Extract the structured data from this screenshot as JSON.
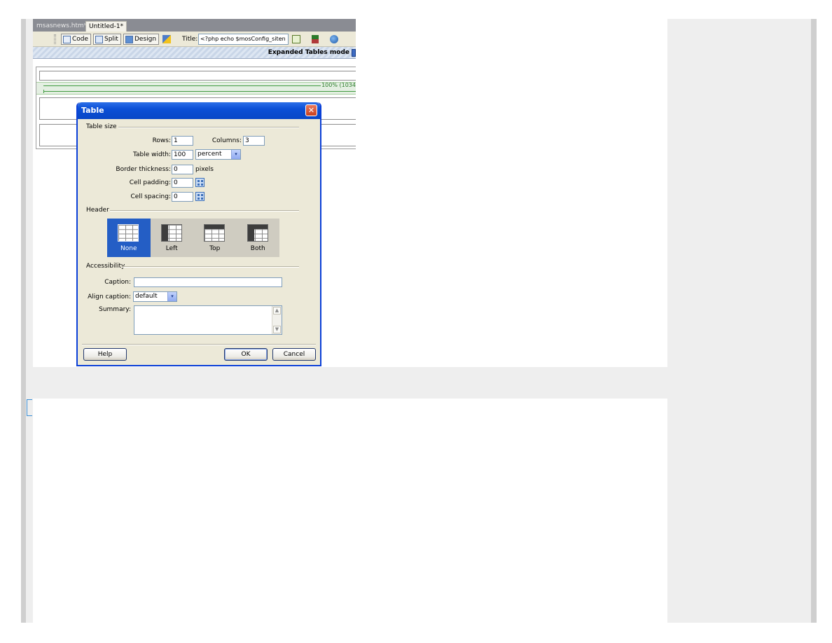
{
  "tabs": [
    {
      "label": "msasnews.htm*"
    },
    {
      "label": "Untitled-1*"
    }
  ],
  "toolbar": {
    "code_label": "Code",
    "split_label": "Split",
    "design_label": "Design",
    "title_label": "Title:",
    "title_value": "<?php echo $mosConfig_siten"
  },
  "mode_bar": {
    "text": "Expanded Tables mode"
  },
  "canvas": {
    "width_indicator": "100% (1034"
  },
  "dialog": {
    "title": "Table",
    "close_symbol": "✕",
    "table_size": {
      "section": "Table size",
      "rows_label": "Rows:",
      "rows_value": "1",
      "columns_label": "Columns:",
      "columns_value": "3",
      "width_label": "Table width:",
      "width_value": "100",
      "width_unit": "percent",
      "border_label": "Border thickness:",
      "border_value": "0",
      "border_unit": "pixels",
      "padding_label": "Cell padding:",
      "padding_value": "0",
      "spacing_label": "Cell spacing:",
      "spacing_value": "0"
    },
    "header": {
      "section": "Header",
      "options": [
        {
          "label": "None",
          "selected": true
        },
        {
          "label": "Left",
          "selected": false
        },
        {
          "label": "Top",
          "selected": false
        },
        {
          "label": "Both",
          "selected": false
        }
      ]
    },
    "accessibility": {
      "section": "Accessibility",
      "caption_label": "Caption:",
      "caption_value": "",
      "align_label": "Align caption:",
      "align_value": "default",
      "summary_label": "Summary:",
      "summary_value": ""
    },
    "buttons": {
      "help": "Help",
      "ok": "OK",
      "cancel": "Cancel"
    }
  },
  "colors": {
    "dialog_title": "#0b4fd6",
    "dialog_bg": "#ece9d8",
    "header_selected": "#245ec5",
    "width_indicator": "#2c7d2c"
  },
  "icons": {
    "dropdown": "▾",
    "scroll_up": "▲",
    "scroll_down": "▼"
  }
}
